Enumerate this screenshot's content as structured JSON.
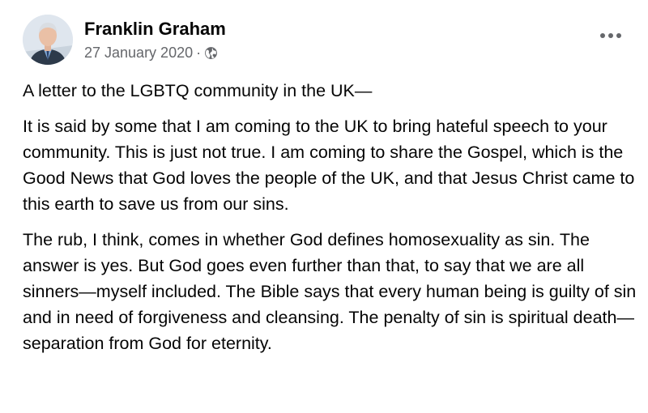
{
  "post": {
    "author": "Franklin Graham",
    "date": "27 January 2020",
    "separator": "·",
    "audience_icon": "globe-icon",
    "more_icon": "more-options-icon",
    "paragraphs": [
      "A letter to the LGBTQ community in the UK—",
      "It is said by some that I am coming to the UK to bring hateful speech to your community. This is just not true. I am coming to share the Gospel, which is the Good News that God loves the people of the UK, and that Jesus Christ came to this earth to save us from our sins.",
      "The rub, I think, comes in whether God defines homosexuality as sin. The answer is yes. But God goes even further than that, to say that we are all sinners—myself included. The Bible says that every human being is guilty of sin and in need of forgiveness and cleansing. The penalty of sin is spiritual death—separation from God for eternity."
    ]
  }
}
